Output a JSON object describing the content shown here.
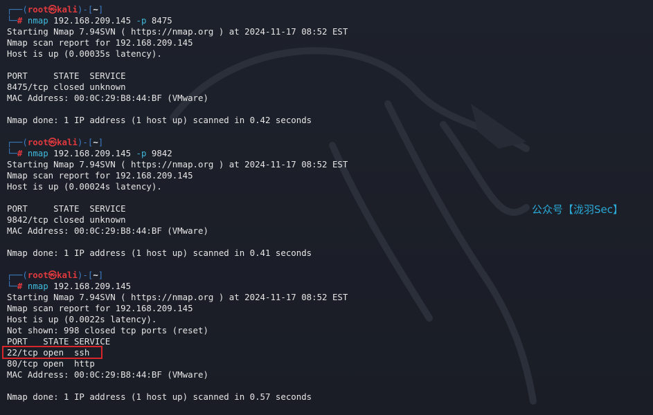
{
  "prompt": {
    "box_open": "┌──(",
    "user": "root㉿kali",
    "mid": ")-[",
    "dir": "~",
    "close": "]",
    "box_cmd": "└─",
    "hash": "#"
  },
  "blocks": [
    {
      "cmd": "nmap",
      "args": " 192.168.209.145 ",
      "flag": "-p",
      "port": " 8475",
      "output": [
        "Starting Nmap 7.94SVN ( https://nmap.org ) at 2024-11-17 08:52 EST",
        "Nmap scan report for 192.168.209.145",
        "Host is up (0.00035s latency).",
        "",
        "PORT     STATE  SERVICE",
        "8475/tcp closed unknown",
        "MAC Address: 00:0C:29:B8:44:BF (VMware)",
        "",
        "Nmap done: 1 IP address (1 host up) scanned in 0.42 seconds",
        ""
      ]
    },
    {
      "cmd": "nmap",
      "args": " 192.168.209.145 ",
      "flag": "-p",
      "port": " 9842",
      "output": [
        "Starting Nmap 7.94SVN ( https://nmap.org ) at 2024-11-17 08:52 EST",
        "Nmap scan report for 192.168.209.145",
        "Host is up (0.00024s latency).",
        "",
        "PORT     STATE  SERVICE",
        "9842/tcp closed unknown",
        "MAC Address: 00:0C:29:B8:44:BF (VMware)",
        "",
        "Nmap done: 1 IP address (1 host up) scanned in 0.41 seconds",
        ""
      ]
    },
    {
      "cmd": "nmap",
      "args": " 192.168.209.145",
      "flag": "",
      "port": "",
      "output": [
        "Starting Nmap 7.94SVN ( https://nmap.org ) at 2024-11-17 08:52 EST",
        "Nmap scan report for 192.168.209.145",
        "Host is up (0.0022s latency).",
        "Not shown: 998 closed tcp ports (reset)",
        "PORT   STATE SERVICE",
        "22/tcp open  ssh",
        "80/tcp open  http",
        "MAC Address: 00:0C:29:B8:44:BF (VMware)",
        "",
        "Nmap done: 1 IP address (1 host up) scanned in 0.57 seconds"
      ]
    }
  ],
  "watermark": "公众号【泷羽Sec】",
  "colors": {
    "background": "#1b1f28",
    "text": "#e6e6e6",
    "prompt_box": "#3b7ec8",
    "prompt_user": "#e0393e",
    "command": "#3fbadc",
    "highlight": "#d8262b",
    "watermark": "#2aa9d6"
  }
}
